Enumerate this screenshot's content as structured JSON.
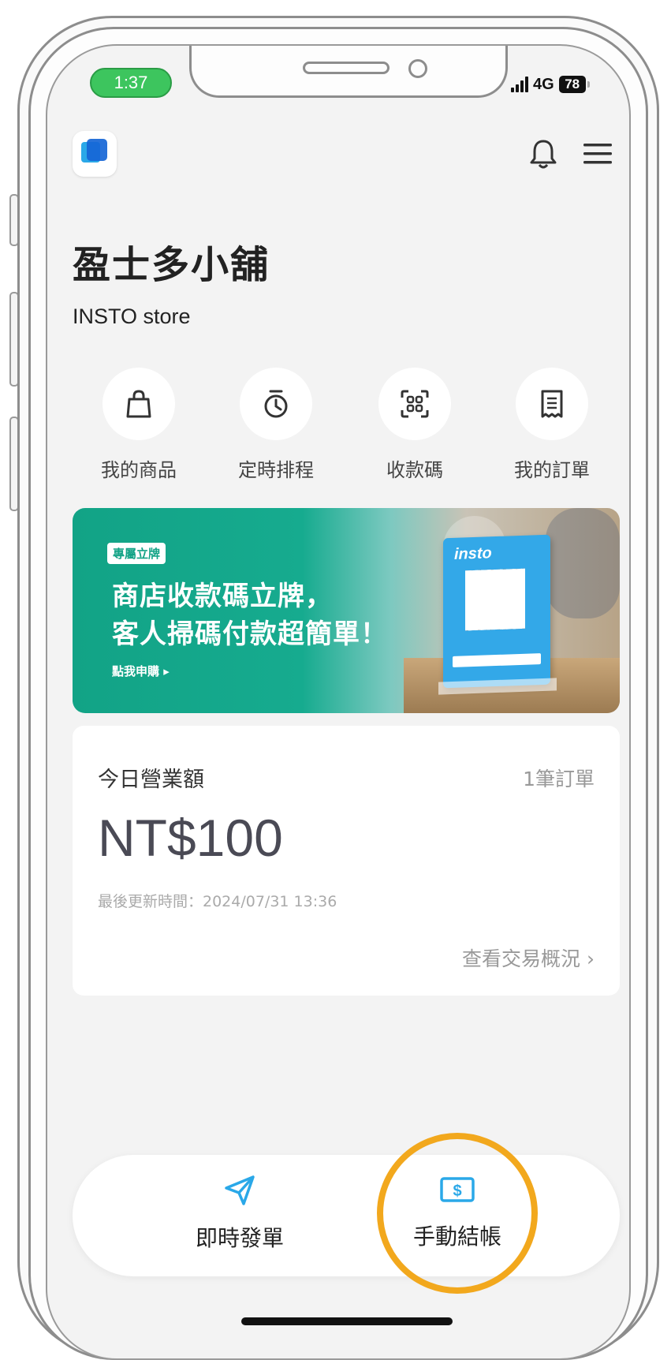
{
  "status_bar": {
    "time": "1:37",
    "network": "4G",
    "battery": "78"
  },
  "header": {
    "store_name": "盈士多小舖",
    "store_subtitle": "INSTO store"
  },
  "quick_actions": [
    {
      "label": "我的商品",
      "icon": "shopping-bag-icon"
    },
    {
      "label": "定時排程",
      "icon": "timer-icon"
    },
    {
      "label": "收款碼",
      "icon": "qr-scan-icon"
    },
    {
      "label": "我的訂單",
      "icon": "receipt-icon"
    }
  ],
  "banner": {
    "tag": "專屬立牌",
    "headline_line1": "商店收款碼立牌，",
    "headline_line2": "客人掃碼付款超簡單！",
    "cta": "點我申購 ▸",
    "product_brand": "insto"
  },
  "revenue_card": {
    "title": "今日營業額",
    "order_count": "1筆訂單",
    "amount": "NT$100",
    "last_updated": "最後更新時間：2024/07/31 13:36",
    "details_link": "查看交易概況 ›"
  },
  "bottom_bar": {
    "instant_order_label": "即時發單",
    "manual_checkout_label": "手動結帳"
  },
  "colors": {
    "accent": "#2aa8e8",
    "highlight": "#f2a81d",
    "banner": "#12a386",
    "status_green": "#3dc55e"
  }
}
